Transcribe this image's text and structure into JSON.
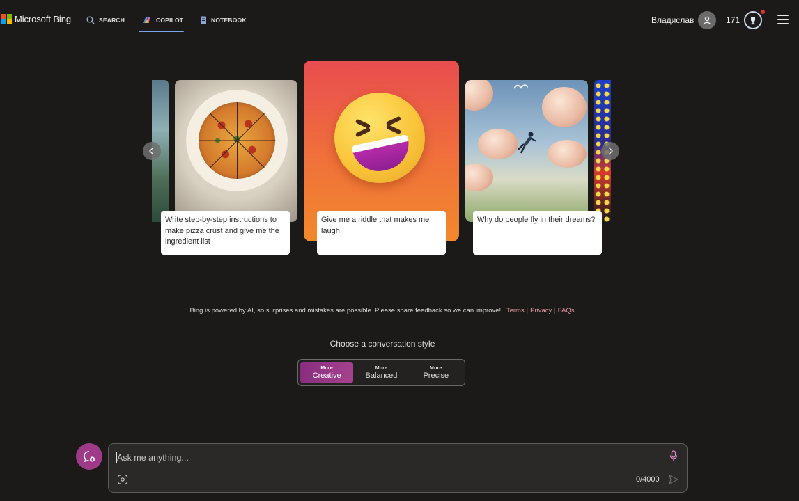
{
  "header": {
    "logo_text": "Microsoft Bing",
    "logo_colors": [
      "#f25022",
      "#7fba00",
      "#00a4ef",
      "#ffb900"
    ],
    "nav": [
      {
        "label": "SEARCH",
        "icon": "search-icon"
      },
      {
        "label": "COPILOT",
        "icon": "copilot-icon",
        "active": true
      },
      {
        "label": "NOTEBOOK",
        "icon": "notebook-icon"
      }
    ],
    "user_name": "Владислав",
    "rewards_points": "171"
  },
  "carousel": {
    "cards": [
      {
        "prompt": "Write step-by-step instructions to make pizza crust and give me the ingredient list",
        "image": "pizza-image"
      },
      {
        "prompt": "Give me a riddle that makes me laugh",
        "image": "laughing-emoji-image"
      },
      {
        "prompt": "Why do people fly in their dreams?",
        "image": "flying-dream-image"
      }
    ]
  },
  "disclaimer": {
    "text": "Bing is powered by AI, so surprises and mistakes are possible. Please share feedback so we can improve!",
    "links": [
      "Terms",
      "Privacy",
      "FAQs"
    ]
  },
  "conversation_style": {
    "title": "Choose a conversation style",
    "options": [
      {
        "more": "More",
        "name": "Creative",
        "active": true
      },
      {
        "more": "More",
        "name": "Balanced"
      },
      {
        "more": "More",
        "name": "Precise"
      }
    ]
  },
  "input": {
    "placeholder": "Ask me anything...",
    "counter": "0/4000"
  },
  "colors": {
    "background": "#1b1a19",
    "accent_creative": "#9e3a88",
    "link": "#e5999a",
    "nav_underline": "#79a6e8"
  }
}
